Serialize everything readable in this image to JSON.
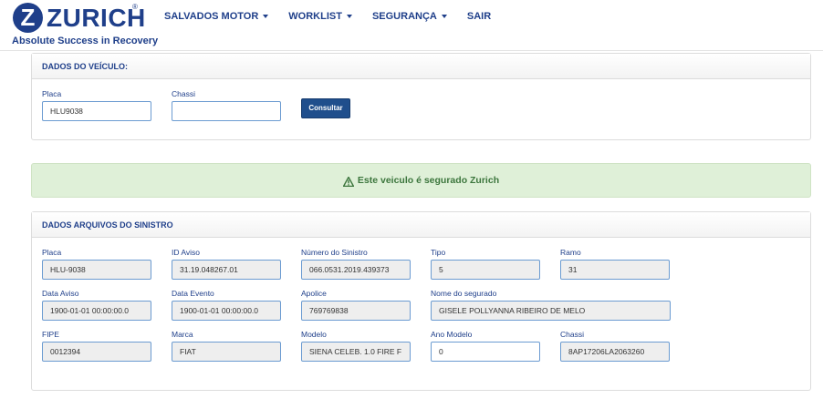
{
  "brand": {
    "logo_letter": "Z",
    "logo_word": "ZURICH",
    "registered_mark": "®",
    "tagline": "Absolute Success in Recovery",
    "color": "#1f3f8a"
  },
  "nav": {
    "items": [
      {
        "label": "SALVADOS MOTOR",
        "has_dropdown": true
      },
      {
        "label": "WORKLIST",
        "has_dropdown": true
      },
      {
        "label": "SEGURANÇA",
        "has_dropdown": true
      },
      {
        "label": "SAIR",
        "has_dropdown": false
      }
    ]
  },
  "vehicle_panel": {
    "title": "DADOS DO VEÍCULO:",
    "placa": {
      "label": "Placa",
      "value": "HLU9038"
    },
    "chassi": {
      "label": "Chassi",
      "value": ""
    },
    "consultar_label": "Consultar"
  },
  "alert": {
    "icon": "warning-icon",
    "text": "Este veiculo é segurado Zurich",
    "color": "#3c763d"
  },
  "claim_panel": {
    "title": "DADOS ARQUIVOS DO SINISTRO",
    "fields": [
      {
        "label": "Placa",
        "value": "HLU-9038"
      },
      {
        "label": "ID Aviso",
        "value": "31.19.048267.01"
      },
      {
        "label": "Número do Sinistro",
        "value": "066.0531.2019.439373"
      },
      {
        "label": "Tipo",
        "value": "5"
      },
      {
        "label": "Ramo",
        "value": "31"
      },
      {
        "label": "Data Aviso",
        "value": "1900-01-01 00:00:00.0"
      },
      {
        "label": "Data Evento",
        "value": "1900-01-01 00:00:00.0"
      },
      {
        "label": "Apolice",
        "value": "769769838"
      },
      {
        "label": "Nome do segurado",
        "value": "GISELE POLLYANNA RIBEIRO DE MELO"
      },
      {
        "label": "FIPE",
        "value": "0012394"
      },
      {
        "label": "Marca",
        "value": "FIAT"
      },
      {
        "label": "Modelo",
        "value": "SIENA CELEB. 1.0 FIRE F"
      },
      {
        "label": "Ano Modelo",
        "value": "0"
      },
      {
        "label": "Chassi",
        "value": "8AP17206LA2063260"
      }
    ]
  }
}
